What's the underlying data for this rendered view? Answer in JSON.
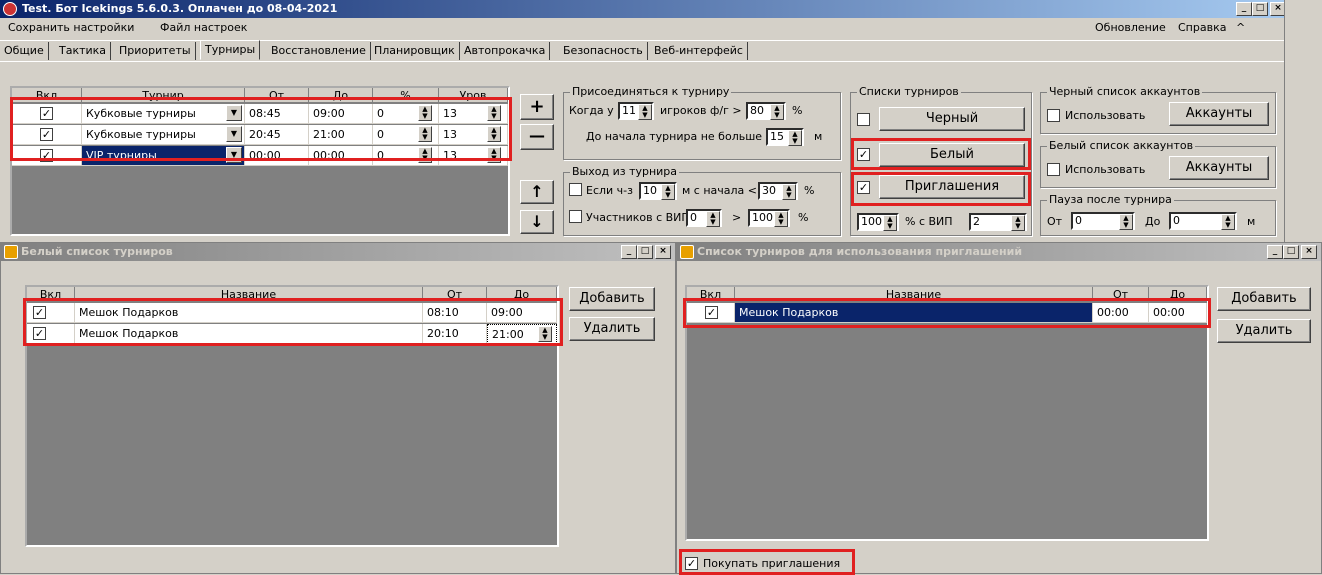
{
  "main_window": {
    "title": "Test. Бот Icekings 5.6.0.3. Оплачен до 08-04-2021",
    "menu_left": [
      "Сохранить настройки",
      "Файл настроек"
    ],
    "menu_right": [
      "Обновление",
      "Справка",
      "^"
    ]
  },
  "tabs": [
    "Общие",
    "Тактика",
    "Приоритеты",
    "Турниры",
    "Восстановление",
    "Планировщик",
    "Автопрокачка",
    "Безопасность",
    "Веб-интерфейс"
  ],
  "tournament_grid": {
    "columns": [
      "Вкл",
      "Турнир",
      "От",
      "До",
      "%",
      "Уров"
    ],
    "rows": [
      {
        "enabled": true,
        "name": "Кубковые турниры",
        "from": "08:45",
        "to": "09:00",
        "percent": "0",
        "level": "13"
      },
      {
        "enabled": true,
        "name": "Кубковые турниры",
        "from": "20:45",
        "to": "21:00",
        "percent": "0",
        "level": "13"
      },
      {
        "enabled": true,
        "name": "VIP турниры",
        "from": "00:00",
        "to": "00:00",
        "percent": "0",
        "level": "13"
      }
    ]
  },
  "grid_buttons": {
    "add": "+",
    "remove": "—",
    "up": "↑",
    "down": "↓"
  },
  "join_group": {
    "title": "Присоединяться к турниру",
    "when_label": "Когда у",
    "when_value": "11",
    "players_label": "игроков ф/г >",
    "players_value": "80",
    "percent_unit": "%",
    "before_label": "До начала турнира не больше",
    "before_value": "15",
    "minutes_unit": "м"
  },
  "exit_group": {
    "title": "Выход из турнира",
    "if_label": "Если ч-з",
    "if_value": "10",
    "since_label": "м с начала <",
    "since_value": "30",
    "percent_unit": "%",
    "vip_label": "Участников с ВИП",
    "vip_value": "0",
    "vip_gt": ">",
    "vip_pct": "100",
    "vip_unit": "%"
  },
  "lists_group": {
    "title": "Списки турниров",
    "black_label": "Черный",
    "white_label": "Белый",
    "invites_label": "Приглашения",
    "pct_value": "100",
    "pct_label": "% с ВИП",
    "count_value": "2"
  },
  "blacklist_group": {
    "title": "Черный список аккаунтов",
    "use_label": "Использовать",
    "button": "Аккаунты"
  },
  "whitelist_group": {
    "title": "Белый список аккаунтов",
    "use_label": "Использовать",
    "button": "Аккаунты"
  },
  "pause_group": {
    "title": "Пауза после турнира",
    "from_label": "От",
    "from_value": "0",
    "to_label": "До",
    "to_value": "0",
    "unit": "м"
  },
  "white_window": {
    "title": "Белый список турниров",
    "columns": [
      "Вкл",
      "Название",
      "От",
      "До"
    ],
    "rows": [
      {
        "enabled": true,
        "name": "Мешок Подарков",
        "from": "08:10",
        "to": "09:00"
      },
      {
        "enabled": true,
        "name": "Мешок Подарков",
        "from": "20:10",
        "to": "21:00"
      }
    ],
    "add_button": "Добавить",
    "delete_button": "Удалить"
  },
  "invite_window": {
    "title": "Список турниров для использования приглашений",
    "columns": [
      "Вкл",
      "Название",
      "От",
      "До"
    ],
    "rows": [
      {
        "enabled": true,
        "name": "Мешок Подарков",
        "from": "00:00",
        "to": "00:00"
      }
    ],
    "add_button": "Добавить",
    "delete_button": "Удалить",
    "buy_label": "Покупать приглашения"
  },
  "colors": {
    "highlight": "#e02020",
    "selection": "#0a246a",
    "face": "#d4d0c8"
  }
}
